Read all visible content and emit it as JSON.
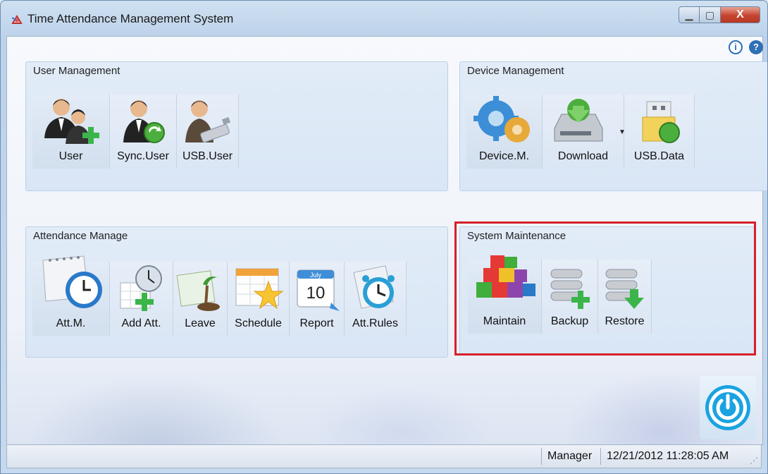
{
  "window": {
    "title": "Time Attendance Management System",
    "controls": [
      "minimize",
      "maximize",
      "close"
    ]
  },
  "help": {
    "info_icon": "info-icon",
    "help_icon": "help-icon"
  },
  "user_management": {
    "title": "User Management",
    "buttons": [
      {
        "label": "User",
        "icon": "user-add-icon"
      },
      {
        "label": "Sync.User",
        "icon": "user-sync-icon"
      },
      {
        "label": "USB.User",
        "icon": "usb-user-icon"
      }
    ]
  },
  "device_management": {
    "title": "Device Management",
    "buttons": [
      {
        "label": "Device.M.",
        "icon": "gears-icon"
      },
      {
        "label": "Download",
        "icon": "download-drive-icon"
      },
      {
        "label": "USB.Data",
        "icon": "usb-data-icon"
      }
    ]
  },
  "attendance_manage": {
    "title": "Attendance Manage",
    "buttons": [
      {
        "label": "Att.M.",
        "icon": "calendar-clock-icon"
      },
      {
        "label": "Add Att.",
        "icon": "add-attendance-icon"
      },
      {
        "label": "Leave",
        "icon": "leave-icon"
      },
      {
        "label": "Schedule",
        "icon": "schedule-icon"
      },
      {
        "label": "Report",
        "icon": "report-calendar-icon"
      },
      {
        "label": "Att.Rules",
        "icon": "alarm-clock-icon"
      }
    ],
    "report_month": "July",
    "report_day": "10"
  },
  "system_maintenance": {
    "title": "System Maintenance",
    "buttons": [
      {
        "label": "Maintain",
        "icon": "blocks-icon"
      },
      {
        "label": "Backup",
        "icon": "database-add-icon"
      },
      {
        "label": "Restore",
        "icon": "database-restore-icon"
      }
    ]
  },
  "status": {
    "user": "Manager",
    "datetime": "12/21/2012 11:28:05 AM"
  },
  "colors": {
    "highlight_border": "#d6202a",
    "power_button": "#1aa3e0",
    "close_button": "#c5442e"
  }
}
